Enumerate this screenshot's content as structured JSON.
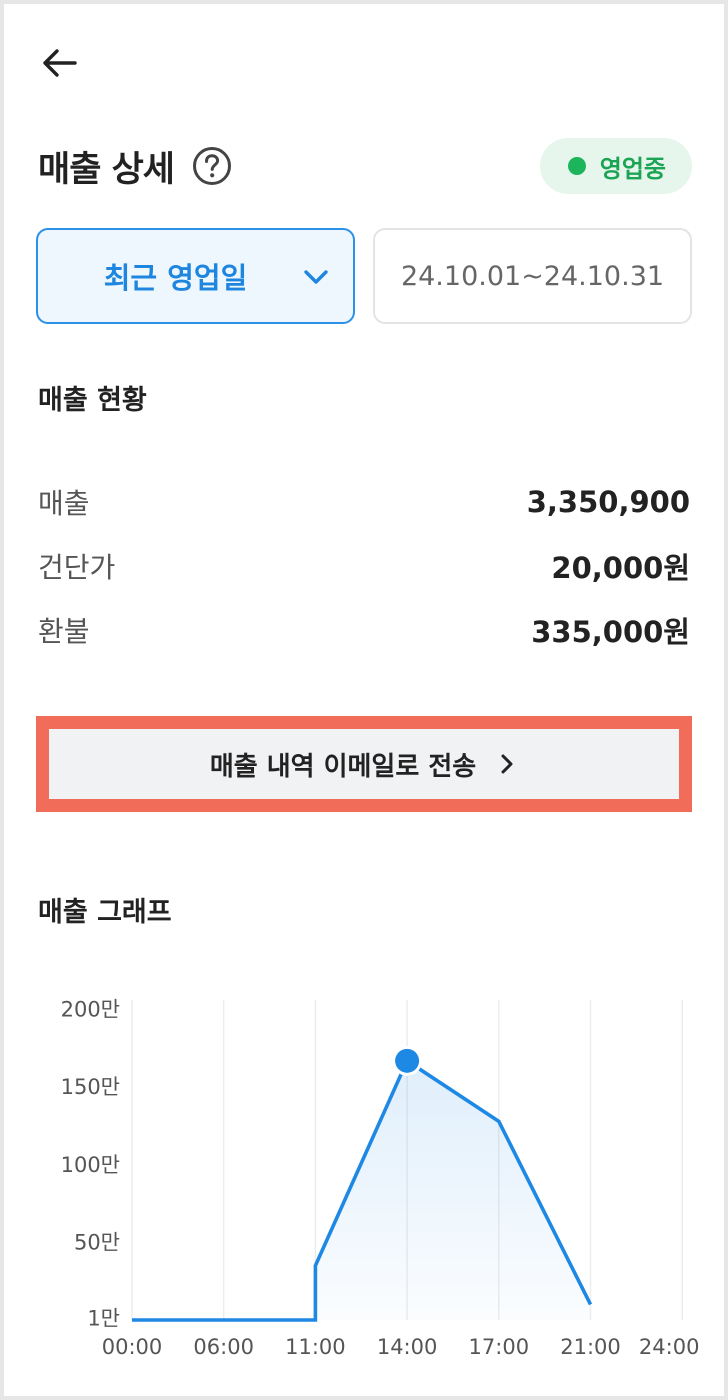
{
  "header": {
    "back_icon": "arrow-left-icon",
    "title": "매출 상세",
    "help_icon": "question-circle-icon"
  },
  "status": {
    "label": "영업중",
    "color": "#1db55c"
  },
  "filter": {
    "period_label": "최근 영업일",
    "date_range": "24.10.01~24.10.31"
  },
  "summary": {
    "title": "매출 현황",
    "rows": [
      {
        "label": "매출",
        "value": "3,350,900"
      },
      {
        "label": "건단가",
        "value": "20,000원"
      },
      {
        "label": "환불",
        "value": "335,000원"
      }
    ]
  },
  "email_button": {
    "label": "매출 내역 이메일로 전송",
    "highlight_color": "#f26c5a"
  },
  "graph": {
    "title": "매출 그래프"
  },
  "chart_data": {
    "type": "area",
    "x_tick_labels": [
      "00:00",
      "06:00",
      "11:00",
      "14:00",
      "17:00",
      "21:00",
      "24:00"
    ],
    "y_tick_labels": [
      "1만",
      "50만",
      "100만",
      "150만",
      "200만"
    ],
    "y_tick_values": [
      1,
      50,
      100,
      150,
      200
    ],
    "y_unit": "만",
    "ylim": [
      0,
      200
    ],
    "points": [
      {
        "x": "00:00",
        "y": 0
      },
      {
        "x": "06:00",
        "y": 0
      },
      {
        "x": "11:00",
        "y": 0
      },
      {
        "x": "11:00",
        "y": 35
      },
      {
        "x": "14:00",
        "y": 167
      },
      {
        "x": "17:00",
        "y": 128
      },
      {
        "x": "21:00",
        "y": 10
      }
    ],
    "highlight_x": "14:00",
    "line_color": "#1e88e5",
    "grid": true
  }
}
